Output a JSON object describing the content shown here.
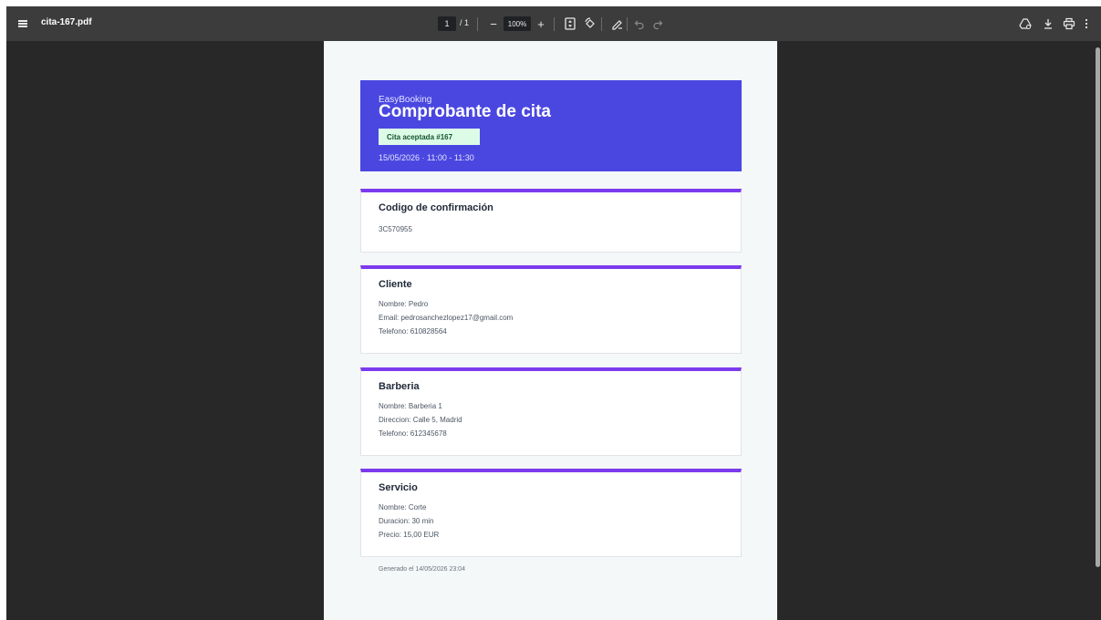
{
  "toolbar": {
    "file_name": "cita-167.pdf",
    "page_current": "1",
    "page_total": "/ 1",
    "zoom_minus": "−",
    "zoom": "100%",
    "zoom_plus": "+",
    "icons": [
      "menu-icon",
      "fit-page-icon",
      "rotate-icon",
      "annotate-icon",
      "undo-icon",
      "redo-icon",
      "drive-icon",
      "download-icon",
      "print-icon",
      "more-icon"
    ]
  },
  "document": {
    "hero": {
      "brand": "EasyBooking",
      "title": "Comprobante de cita",
      "badge": "Cita aceptada #167",
      "datetime": "15/05/2026 · 11:00 - 11:30"
    },
    "confirmation": {
      "title": "Codigo de confirmación",
      "code": "3C570955"
    },
    "client": {
      "title": "Cliente",
      "name": "Nombre: Pedro",
      "email": "Email: pedrosanchezlopez17@gmail.com",
      "phone": "Telefono: 610828564"
    },
    "barbershop": {
      "title": "Barberia",
      "name": "Nombre: Barberia 1",
      "address": "Direccion: Calle 5, Madrid",
      "phone": "Telefono: 612345678"
    },
    "service": {
      "title": "Servicio",
      "name": "Nombre: Corte",
      "duration": "Duracion: 30 min",
      "price": "Precio: 15,00 EUR"
    },
    "footer": "Generado el 14/05/2026 23:04"
  },
  "colors": {
    "toolbar_bg": "#3c3c3c",
    "viewer_bg": "#282828",
    "hero_bg": "#4a47e0",
    "card_accent": "#7c3aed",
    "badge_bg": "#dcfce7",
    "badge_text": "#14532d"
  }
}
